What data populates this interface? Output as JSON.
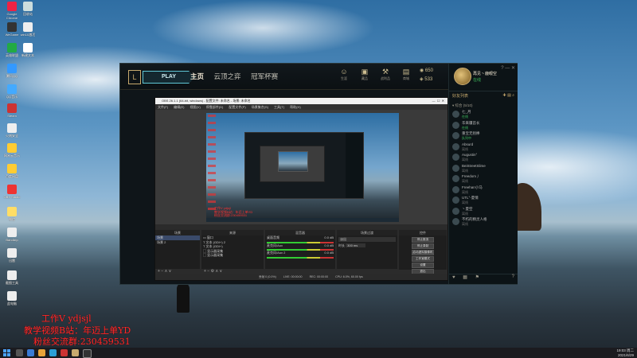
{
  "desktop": {
    "icons": [
      {
        "label": "Google Chrome"
      },
      {
        "label": "回收站"
      },
      {
        "label": "WeGame"
      },
      {
        "label": "win10激活"
      },
      {
        "label": "英雄联盟"
      },
      {
        "label": "新建文本"
      },
      {
        "label": "腾讯QQ"
      },
      {
        "label": "QQ音乐"
      },
      {
        "label": "Steam"
      },
      {
        "label": "火绒安全"
      },
      {
        "label": "网易云音乐"
      },
      {
        "label": "百度网盘"
      },
      {
        "label": "OBS Studio"
      },
      {
        "label": "微信"
      },
      {
        "label": "Bandizip"
      },
      {
        "label": "迅雷"
      },
      {
        "label": "截图工具"
      },
      {
        "label": "此电脑"
      }
    ],
    "watermark": {
      "line1": "工作V ydjsjl",
      "line2": "教学视频B站：年迈上单YD",
      "line3": "粉丝交流群:230459531"
    }
  },
  "client": {
    "play_label": "PLAY",
    "nav": [
      "主页",
      "云顶之弈",
      "冠军杯赛"
    ],
    "nav_icons": [
      {
        "icon": "profile-icon",
        "label": "生涯"
      },
      {
        "icon": "collection-icon",
        "label": "藏品"
      },
      {
        "icon": "loot-icon",
        "label": "战利品"
      },
      {
        "icon": "shop-icon",
        "label": "商城"
      }
    ],
    "currency": {
      "rp": "650",
      "be": "533"
    },
    "profile": {
      "name": "再见丶鹿眼空",
      "status": "在线"
    },
    "social_title": "好友列表",
    "group_label": "▾ 综合 (5/10)",
    "friends": [
      {
        "name": "七_月",
        "status": "在线",
        "online": true
      },
      {
        "name": "华来疆首长",
        "status": "在线",
        "online": true
      },
      {
        "name": "重宝无别棒",
        "status": "队列中",
        "online": true
      },
      {
        "name": "Absurd",
        "status": "离线",
        "online": false
      },
      {
        "name": "Augustin°",
        "status": "离线",
        "online": false
      },
      {
        "name": "BeiStreetSlime",
        "status": "离线",
        "online": false
      },
      {
        "name": "Freedom丿",
        "status": "离线",
        "online": false
      },
      {
        "name": "Freehan小马",
        "status": "离线",
        "online": false
      },
      {
        "name": "UTL°-夏情",
        "status": "离线",
        "online": false
      },
      {
        "name": "丶夏空",
        "status": "离线",
        "online": false
      },
      {
        "name": "不朽的精灵人格",
        "status": "离线",
        "online": false
      }
    ]
  },
  "obs": {
    "title": "OBS 26.1.1 (64-bit, windows) - 配置文件: 未命名 - 场景: 未命名",
    "menu": [
      "文件(F)",
      "编辑(E)",
      "视图(V)",
      "停靠部件(D)",
      "配置文件(P)",
      "场景集合(S)",
      "工具(T)",
      "帮助(H)"
    ],
    "canvas_watermark": [
      "工作V ydjsjl",
      "教学视频B站：年迈上单YD",
      "粉丝交流群:230459531"
    ],
    "scenes_header": "场景",
    "scenes": [
      "场景",
      "场景 2"
    ],
    "sources_header": "来源",
    "sources": [
      "窗口",
      "文本 (GDI+) 2",
      "文本 (GDI+)",
      "显示器采集",
      "显示器采集"
    ],
    "mixer_header": "混音器",
    "mixer": [
      {
        "name": "桌面音频",
        "level": "0.0 dB"
      },
      {
        "name": "麦克风/Aux",
        "level": "0.0 dB"
      },
      {
        "name": "麦克风/Aux 2",
        "level": "0.0 dB"
      }
    ],
    "transition_header": "场景过渡",
    "transition": {
      "type": "淡出",
      "duration_label": "时长",
      "duration": "300 ms"
    },
    "controls_header": "控件",
    "controls": [
      "停止推流",
      "停止录制",
      "启动虚拟摄像机",
      "工作室模式",
      "设置",
      "退出"
    ],
    "status": {
      "live": "LIVE: 00:00:00",
      "rec": "REC: 00:00:00",
      "cpu": "CPU: 6.0%, 60.00 fps",
      "dropped": "丢帧 0 (0.0%)"
    }
  },
  "taskbar": {
    "time": "19:03 周二",
    "date": "2021/6/29"
  },
  "colors": {
    "accent_gold": "#c8aa6e",
    "play_cyan": "#5fc7d6",
    "online_green": "#3fbf5f",
    "watermark_red": "#ff2a2a"
  }
}
